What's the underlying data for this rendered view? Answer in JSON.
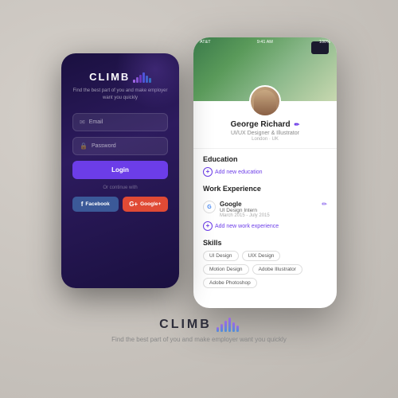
{
  "app": {
    "name": "CLIMB",
    "tagline": "Find the best part of you and make\nemployer want you quickly"
  },
  "login": {
    "logo_text": "CLIMB",
    "tagline": "Find the best part of you and make\nemployer want you quickly",
    "email_placeholder": "Email",
    "password_placeholder": "Password",
    "login_button": "Login",
    "or_continue": "Or continue with",
    "facebook_btn": "Facebook",
    "google_btn": "Google+"
  },
  "profile": {
    "status_bar": {
      "carrier": "AT&T",
      "time": "9:41 AM",
      "battery": "100%"
    },
    "name": "George Richard",
    "title": "UI/UX Designer & Illustrator",
    "location": "London · UK",
    "sections": {
      "education": {
        "title": "Education",
        "add_label": "Add new education"
      },
      "work_experience": {
        "title": "Work Experience",
        "add_label": "Add new work experience",
        "items": [
          {
            "company": "Google",
            "role": "UI Design Intern",
            "dates": "March 2015 - July 2015"
          }
        ]
      },
      "skills": {
        "title": "Skills",
        "items": [
          "UI Design",
          "UIX Design",
          "Motion Design",
          "Adobe Illustrator",
          "Adobe Photoshop"
        ]
      }
    }
  },
  "bottom_logo": {
    "text": "CLIMB",
    "tagline": "Find the best part of you and make\nemployer want you quickly"
  }
}
